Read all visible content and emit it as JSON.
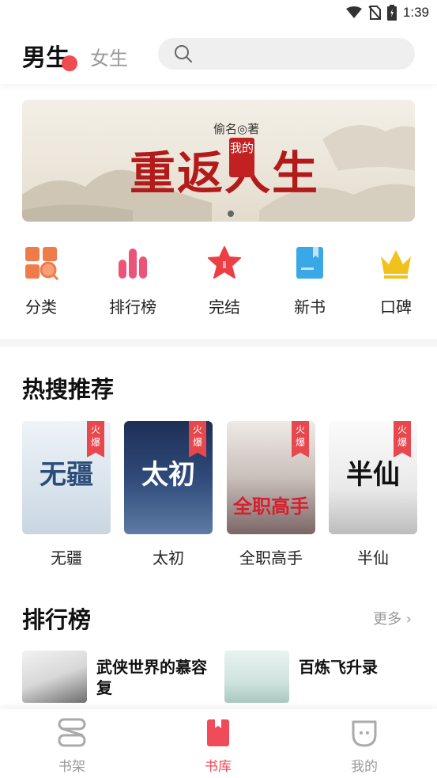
{
  "status_bar": {
    "time": "1:39"
  },
  "header": {
    "tabs": [
      {
        "label": "男生",
        "active": true
      },
      {
        "label": "女生",
        "active": false
      }
    ],
    "search_placeholder": ""
  },
  "banner": {
    "author": "偷名◎著",
    "title": "重返人生",
    "seal": "我的",
    "page_count": 1,
    "current_page": 1
  },
  "categories": [
    {
      "label": "分类",
      "icon": "grid-search-icon",
      "color": "#f07b4a"
    },
    {
      "label": "排行榜",
      "icon": "bar-chart-icon",
      "color": "#ec5477"
    },
    {
      "label": "完结",
      "icon": "star-icon",
      "color": "#ec3f45"
    },
    {
      "label": "新书",
      "icon": "book-icon",
      "color": "#3aa7e6"
    },
    {
      "label": "口碑",
      "icon": "crown-icon",
      "color": "#f2c21c"
    }
  ],
  "hot_search": {
    "title": "热搜推荐",
    "badge": "火爆",
    "books": [
      {
        "name": "无疆",
        "cover_text": "无疆"
      },
      {
        "name": "太初",
        "cover_text": "太初"
      },
      {
        "name": "全职高手",
        "cover_text": "全职高手"
      },
      {
        "name": "半仙",
        "cover_text": "半仙"
      }
    ]
  },
  "ranking": {
    "title": "排行榜",
    "more": "更多 ›",
    "items": [
      {
        "title": "武侠世界的慕容复"
      },
      {
        "title": "百炼飞升录"
      }
    ]
  },
  "bottom_nav": [
    {
      "label": "书架",
      "icon": "bookshelf-icon",
      "active": false
    },
    {
      "label": "书库",
      "icon": "library-icon",
      "active": true
    },
    {
      "label": "我的",
      "icon": "profile-icon",
      "active": false
    }
  ],
  "colors": {
    "accent": "#ef4b58",
    "inactive": "#999999"
  }
}
